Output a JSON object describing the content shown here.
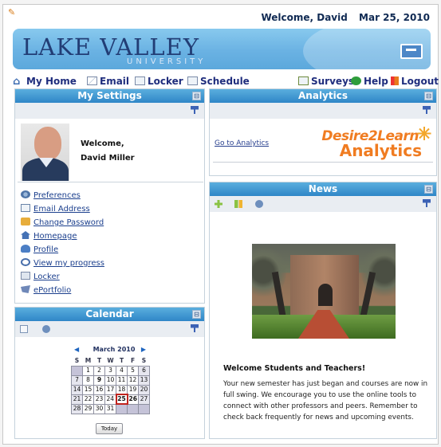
{
  "header": {
    "welcome": "Welcome, David",
    "date": "Mar 25, 2010"
  },
  "brand": {
    "name": "LAKE VALLEY",
    "subtitle": "UNIVERSITY"
  },
  "nav": {
    "home": "My Home",
    "email": "Email",
    "locker": "Locker",
    "schedule": "Schedule",
    "surveys": "Surveys",
    "help": "Help",
    "logout": "Logout"
  },
  "settings": {
    "title": "My Settings",
    "welcome_label": "Welcome,",
    "user_name": "David Miller",
    "links": [
      {
        "label": "Preferences"
      },
      {
        "label": "Email Address"
      },
      {
        "label": "Change Password"
      },
      {
        "label": "Homepage"
      },
      {
        "label": "Profile"
      },
      {
        "label": "View my progress"
      },
      {
        "label": "Locker"
      },
      {
        "label": "ePortfolio"
      }
    ]
  },
  "calendar": {
    "title": "Calendar",
    "month": "March 2010",
    "weekdays": [
      "S",
      "M",
      "T",
      "W",
      "T",
      "F",
      "S"
    ],
    "today_label": "Today"
  },
  "analytics": {
    "title": "Analytics",
    "link": "Go to Analytics",
    "logo_primary": "Desire2Learn",
    "logo_secondary": "Analytics"
  },
  "news": {
    "title": "News",
    "headline": "Welcome Students and Teachers!",
    "body": "Your new semester has just began and courses are now in full swing. We encourage you to use the online tools to connect with other professors and peers. Remember to check back frequently for news and upcoming events."
  },
  "colors": {
    "brand_blue": "#2f86c7",
    "accent_orange": "#f07c21"
  }
}
